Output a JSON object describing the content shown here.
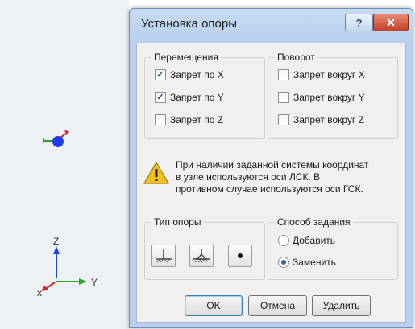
{
  "dialog": {
    "title": "Установка опоры",
    "help_icon": "question-icon",
    "close_icon": "close-icon"
  },
  "movement": {
    "title": "Перемещения",
    "items": [
      {
        "label": "Запрет по X",
        "checked": true
      },
      {
        "label": "Запрет по Y",
        "checked": true
      },
      {
        "label": "Запрет по Z",
        "checked": false
      }
    ]
  },
  "rotation": {
    "title": "Поворот",
    "items": [
      {
        "label": "Запрет вокруг X",
        "checked": false
      },
      {
        "label": "Запрет вокруг Y",
        "checked": false
      },
      {
        "label": "Запрет вокруг Z",
        "checked": false
      }
    ]
  },
  "warning": {
    "icon": "warning-icon",
    "lines": [
      "При наличии заданной системы координат",
      "в узле используются оси ЛСК. В",
      "противном случае используются оси ГСК."
    ]
  },
  "support_type": {
    "title": "Тип опоры",
    "buttons": [
      "fixed-support-icon",
      "pinned-support-icon",
      "point-support-icon"
    ]
  },
  "method": {
    "title": "Способ задания",
    "options": [
      {
        "label": "Добавить",
        "selected": false
      },
      {
        "label": "Заменить",
        "selected": true
      }
    ]
  },
  "buttons": {
    "ok": "OK",
    "cancel": "Отмена",
    "delete": "Удалить"
  },
  "viewport": {
    "axis_z": "Z",
    "axis_y": "Y",
    "axis_x": "x"
  },
  "colors": {
    "title_bar": "#b9d1ee",
    "close_button": "#c2412a",
    "node": "#1f3fe0",
    "axis_z": "#1f3fe0",
    "axis_y": "#2aa52a",
    "axis_x": "#d81e1e"
  }
}
